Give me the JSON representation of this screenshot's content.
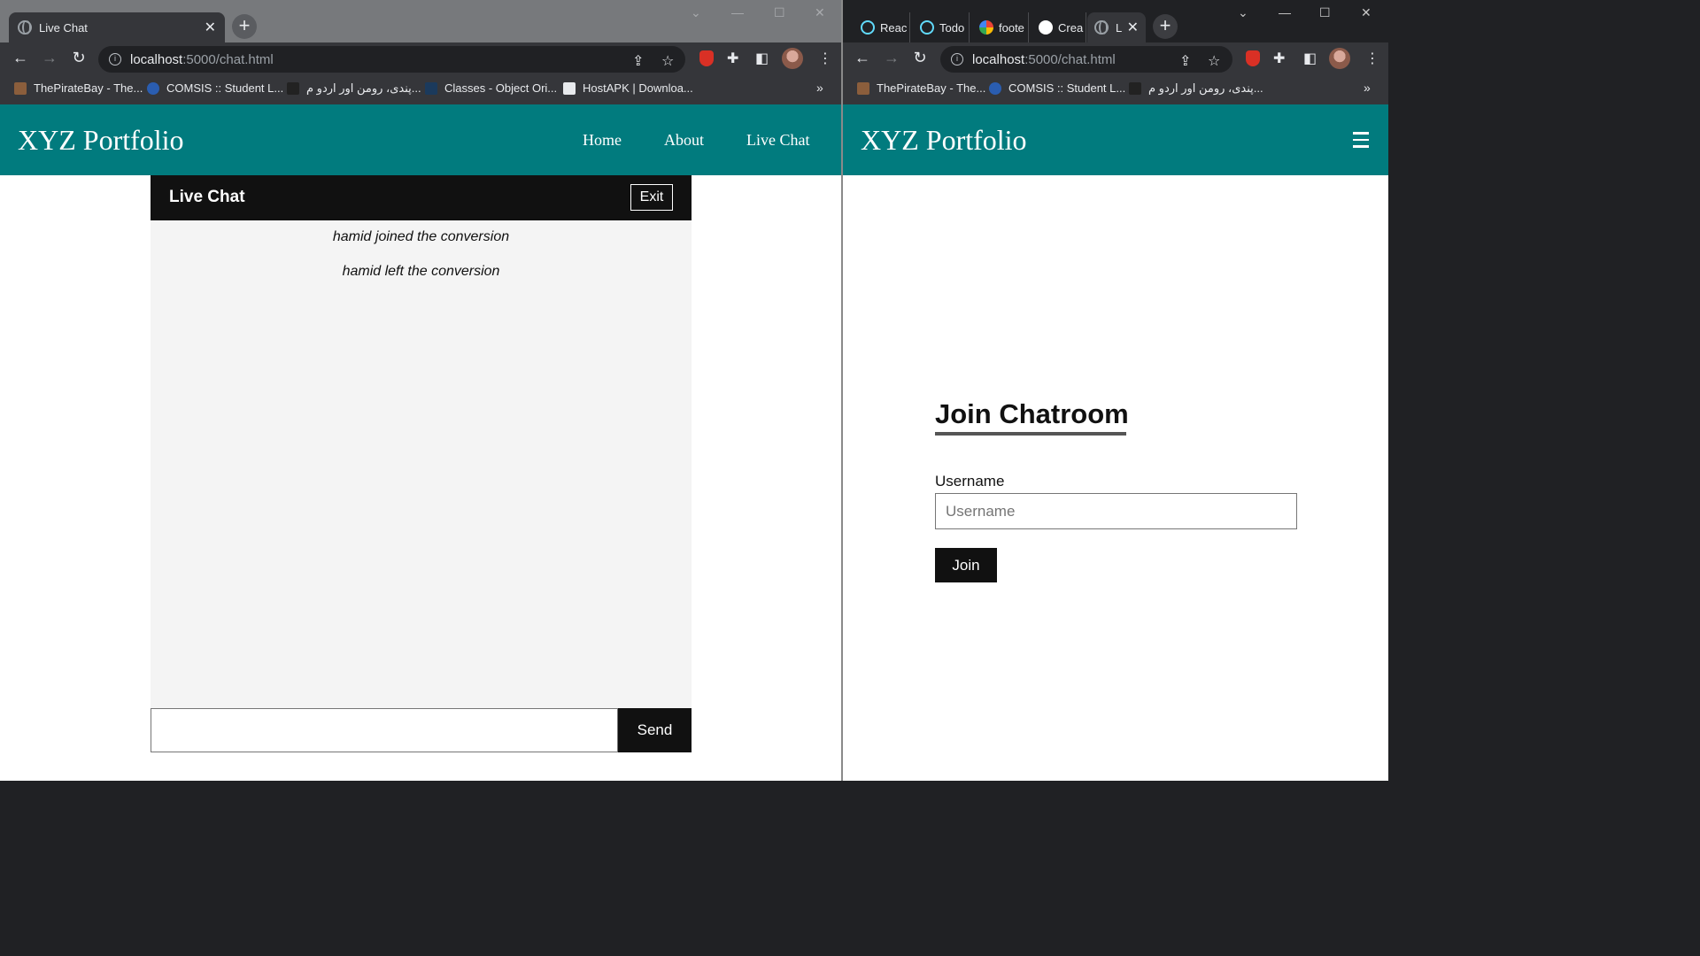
{
  "left_window": {
    "tab": {
      "title": "Live Chat",
      "close": "✕"
    },
    "new_tab": "+",
    "url": {
      "host": "localhost",
      "path": ":5000/chat.html"
    },
    "bookmarks": [
      {
        "label": "ThePirateBay - The...",
        "color": "#8b5e3c"
      },
      {
        "label": "COMSIS :: Student L...",
        "color": "#2a5db0"
      },
      {
        "label": "پندی، رومن اور اردو م...",
        "color": "#222222"
      },
      {
        "label": "Classes - Object Ori...",
        "color": "#1b3a5c"
      },
      {
        "label": "HostAPK | Downloa...",
        "color": "#444444"
      }
    ],
    "bookmarks_more": "»",
    "page": {
      "brand": "XYZ Portfolio",
      "nav": [
        "Home",
        "About",
        "Live Chat"
      ],
      "chat": {
        "title": "Live Chat",
        "exit_label": "Exit",
        "messages": [
          "hamid joined the conversion",
          "hamid left the conversion"
        ],
        "input_value": "",
        "send_label": "Send"
      }
    }
  },
  "right_window": {
    "tabs": [
      {
        "label": "Reac",
        "icon": "react-icon",
        "color": "#61dafb"
      },
      {
        "label": "Todo",
        "icon": "react-icon",
        "color": "#61dafb"
      },
      {
        "label": "foote",
        "icon": "google-icon",
        "color": "#4285f4"
      },
      {
        "label": "Crea",
        "icon": "github-icon",
        "color": "#ffffff"
      },
      {
        "label": "L",
        "icon": "globe-icon",
        "color": "#9aa0a6"
      }
    ],
    "active_tab_close": "✕",
    "new_tab": "+",
    "url": {
      "host": "localhost",
      "path": ":5000/chat.html"
    },
    "bookmarks": [
      {
        "label": "ThePirateBay - The...",
        "color": "#8b5e3c"
      },
      {
        "label": "COMSIS :: Student L...",
        "color": "#2a5db0"
      },
      {
        "label": "پندی، رومن اور اردو م...",
        "color": "#222222"
      }
    ],
    "bookmarks_more": "»",
    "page": {
      "brand": "XYZ Portfolio",
      "join": {
        "title": "Join Chatroom",
        "username_label": "Username",
        "username_placeholder": "Username",
        "join_label": "Join"
      }
    }
  },
  "colors": {
    "nav_teal": "#017b7e",
    "chat_dark": "#111111",
    "chat_bg": "#f4f4f4"
  }
}
